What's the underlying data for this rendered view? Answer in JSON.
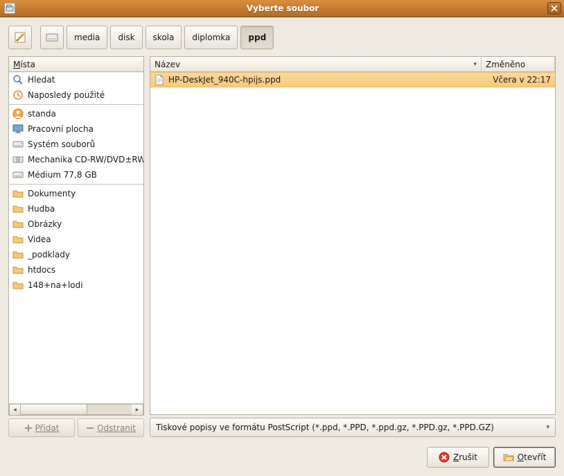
{
  "window": {
    "title": "Vyberte soubor"
  },
  "breadcrumb": [
    "media",
    "disk",
    "skola",
    "diplomka",
    "ppd"
  ],
  "places_header": "Místa",
  "places_header_underline": "M",
  "places": {
    "group1": [
      {
        "icon": "search",
        "label": "Hledat"
      },
      {
        "icon": "recent",
        "label": "Naposledy použité"
      }
    ],
    "group2": [
      {
        "icon": "user",
        "label": "standa"
      },
      {
        "icon": "desktop",
        "label": "Pracovní plocha"
      },
      {
        "icon": "disk",
        "label": "Systém souborů"
      },
      {
        "icon": "optical",
        "label": "Mechanika CD-RW/DVD±RW"
      },
      {
        "icon": "disk",
        "label": "Médium 77,8 GB"
      }
    ],
    "group3": [
      {
        "icon": "folder",
        "label": "Dokumenty"
      },
      {
        "icon": "folder",
        "label": "Hudba"
      },
      {
        "icon": "folder",
        "label": "Obrázky"
      },
      {
        "icon": "folder",
        "label": "Videa"
      },
      {
        "icon": "folder",
        "label": "_podklady"
      },
      {
        "icon": "folder",
        "label": "htdocs"
      },
      {
        "icon": "folder",
        "label": "148+na+lodi"
      }
    ]
  },
  "addremove": {
    "add": "Přidat",
    "remove": "Odstranit"
  },
  "filelist": {
    "col_name": "Název",
    "col_modified": "Změněno",
    "files": [
      {
        "name": "HP-DeskJet_940C-hpijs.ppd",
        "modified": "Včera v 22:17",
        "selected": true
      }
    ]
  },
  "filter": "Tiskové popisy ve formátu PostScript (*.ppd, *.PPD, *.ppd.gz, *.PPD.gz, *.PPD.GZ)",
  "buttons": {
    "cancel": "Zrušit",
    "open": "Otevřít"
  }
}
